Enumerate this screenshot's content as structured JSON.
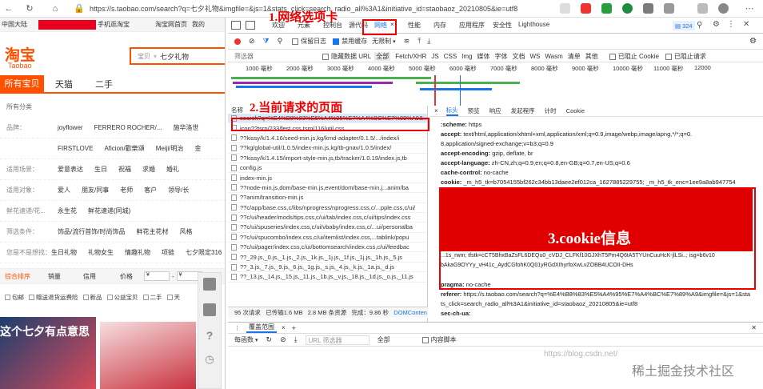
{
  "browser": {
    "url": "https://s.taobao.com/search?q=七夕礼物&imgfile=&js=1&stats_click=search_radio_all%3A1&initiative_id=staobaoz_20210805&ie=utf8"
  },
  "taobao": {
    "topbar": {
      "region": "中国大陆",
      "welcome": "手机逛淘宝",
      "links": [
        "淘宝网首页",
        "我的"
      ]
    },
    "logo_cn": "淘宝",
    "logo_en": "Taobao",
    "search_tab": "宝贝",
    "search_query": "七夕礼物",
    "nav": [
      "所有宝贝",
      "天猫",
      "二手"
    ],
    "all_categories": "所有分类",
    "filters": [
      {
        "label": "品牌：",
        "values": [
          "joyflower",
          "FERRERO ROCHER/...",
          "施华洛世"
        ]
      },
      {
        "label": "",
        "values": [
          "FIRSTLOVE",
          "Aficion/歡樂頌",
          "Meiji/明治",
          "金"
        ]
      },
      {
        "label": "适用场景：",
        "values": [
          "爱意表达",
          "生日",
          "祝福",
          "求婚",
          "婚礼"
        ]
      },
      {
        "label": "适用对象：",
        "values": [
          "爱人",
          "朋友/同事",
          "老师",
          "客户",
          "领导/长"
        ]
      },
      {
        "label": "鲜花速递/花...",
        "values": [
          "永生花",
          "鲜花速递(同城)"
        ]
      },
      {
        "label": "筛选条件：",
        "values": [
          "饰品/流行首饰/时尚饰品",
          "鲜花主花材",
          "风格"
        ]
      },
      {
        "label": "您是不是想找：",
        "values": [
          "生日礼物",
          "礼物女生",
          "情趣礼物",
          "项链",
          "七夕限定316"
        ]
      }
    ],
    "sort": [
      "综合排序",
      "销量",
      "信用",
      "价格"
    ],
    "price_min": "¥",
    "price_max": "¥",
    "checkboxes": [
      "包邮",
      "赠送退货运费险",
      "新品",
      "公益宝贝",
      "二手",
      "天"
    ],
    "banner_text": "这个七夕有点意思"
  },
  "devtools": {
    "tabs": [
      "欢迎",
      "元素",
      "控制台",
      "源代码",
      "网络",
      "性能",
      "内存",
      "应用程序",
      "安全性",
      "Lighthouse"
    ],
    "active_tab": "网络",
    "issues": "324",
    "toolbar": {
      "preserve_log": "保留日志",
      "disable_cache": "禁用缓存",
      "throttle": "无限制"
    },
    "filter": {
      "placeholder": "筛选器",
      "hide_data_url": "隐藏数据 URL",
      "types": [
        "全部",
        "Fetch/XHR",
        "JS",
        "CSS",
        "Img",
        "媒体",
        "字体",
        "文档",
        "WS",
        "Wasm",
        "清单",
        "其他"
      ],
      "blocked_cookies": "已阻止 Cookie",
      "blocked_requests": "已阻止请求"
    },
    "timeline_ticks": [
      "1000 毫秒",
      "2000 毫秒",
      "3000 毫秒",
      "4000 毫秒",
      "5000 毫秒",
      "6000 毫秒",
      "7000 毫秒",
      "8000 毫秒",
      "9000 毫秒",
      "10000 毫秒",
      "11000 毫秒",
      "12000"
    ],
    "name_header": "名称",
    "requests": [
      "search?q=%E4%B8%83%E5%A4%95%E7%A4%BC%E7%89%A9&...",
      "icon??tsrp/233/fest.css,tsrp/116/util.css",
      "??kissy/k/1.4.16/seed-min.js,kg/kmd-adapter/0.1.5/.../index/i",
      "??kg/global-util/1.0.5/index-min.js,kg/tb-gnav/1.0.5/index/",
      "??kissy/k/1.4.15/import-style-min.js,tb/tracker/1.0.19/index.js,tb",
      "config.js",
      "index-min.js",
      "??node-min.js,dom/base-min.js,event/dom/base-min.j...anim/ba",
      "??anim/transition-min.js",
      "??c/app/base.css,c/libs/nprogress/nprogress.css,c/...pple.css,c/ui/",
      "??c/ui/header/mods/tips.css,c/ui/tab/index.css,c/ui/tips/index.css",
      "??c/ui/spuseries/index.css,c/ui/vbaby/index.css,c/...ui/personalba",
      "??c/ui/spucombo/index.css,c/ui/itemlist/index.css,...tablink/popu",
      "??c/ui/pager/index.css,c/ui/bottomsearch/index.css,c/ui/feedbac",
      "??_29.js,_0.js,_1.js,_2.js,_1k.js,_1j.js,_1f.js,_1j.js,_1h.js,_5.js",
      "??_3.js,_7.js,_9.js,_6.js,_1g.js,_s.js,_4.js,_k.js,_1a.js,_d.js",
      "??_13.js,_14.js,_15.js,_11.js,_1b.js,_v.js,_18.js,_1d.js,_o.js,_11.js"
    ],
    "status": {
      "requests": "95 次请求",
      "transferred": "已传输1.6 MB",
      "resources": "2.8 MB 条资源",
      "finish": "完成：9.86 秒",
      "dcl": "DOMConten"
    },
    "detail_tabs": [
      "标头",
      "预览",
      "响应",
      "发起程序",
      "计时",
      "Cookie"
    ],
    "headers": [
      {
        "k": ":scheme:",
        "v": "https"
      },
      {
        "k": "accept:",
        "v": "text/html,application/xhtml+xml,application/xml;q=0.9,image/webp,image/apng,*/*;q=0."
      },
      {
        "k": "",
        "v": "8,application/signed-exchange;v=b3;q=0.9"
      },
      {
        "k": "accept-encoding:",
        "v": "gzip, deflate, br"
      },
      {
        "k": "accept-language:",
        "v": "zh-CN,zh;q=0.9,en;q=0.8,en-GB;q=0.7,en-US;q=0.6"
      },
      {
        "k": "cache-control:",
        "v": "no-cache"
      }
    ],
    "cookie_key": "cookie:",
    "cookie_val": "_m_h5_tk=b7054155bf262c34bb13daee2ef012ca_1627885229755; _m_h5_tk_enc=1ee9a8ab947754",
    "cookie_tail1": "...1s_rwm; tfstk=cCT5BhxBaZsFL6DEQu0_cVDJ_CLFKf10GJXhT5Pm4Q6tA5TYUnCuuHcK-jlLSi..; isg=b6v10",
    "cookie_tail2": "bAkaG9OYYy_vH41c_AydCGfohK0Q01yRGdXIhyrfoXwLvZOBB4UCOII-DHs",
    "after_headers": [
      {
        "k": "pragma:",
        "v": "no-cache"
      },
      {
        "k": "referer:",
        "v": "https://s.taobao.com/search?q=%E4%B8%83%E5%A4%95%E7%A4%BC%E7%89%A9&imgfile=&js=1&sta"
      },
      {
        "k": "",
        "v": "ts_click=search_radio_all%3A1&initiative_id=staobaoz_20210805&ie=utf8"
      },
      {
        "k": "sec-ch-ua:",
        "v": ""
      }
    ],
    "drawer": {
      "tab": "覆盖范围",
      "granularity": "每函数",
      "url_filter_placeholder": "URL 筛选器",
      "all": "全部",
      "content_scripts": "内容脚本"
    }
  },
  "annotations": {
    "a1": "1.网络选项卡",
    "a2": "2.当前请求的页面",
    "a3": "3.cookie信息"
  },
  "watermark": {
    "blog": "https://blog.csdn.net/",
    "site": "稀土掘金技术社区"
  },
  "colors": {
    "taobao_orange": "#ff5000",
    "devtools_blue": "#1a73e8",
    "annotation_red": "#e00000"
  }
}
